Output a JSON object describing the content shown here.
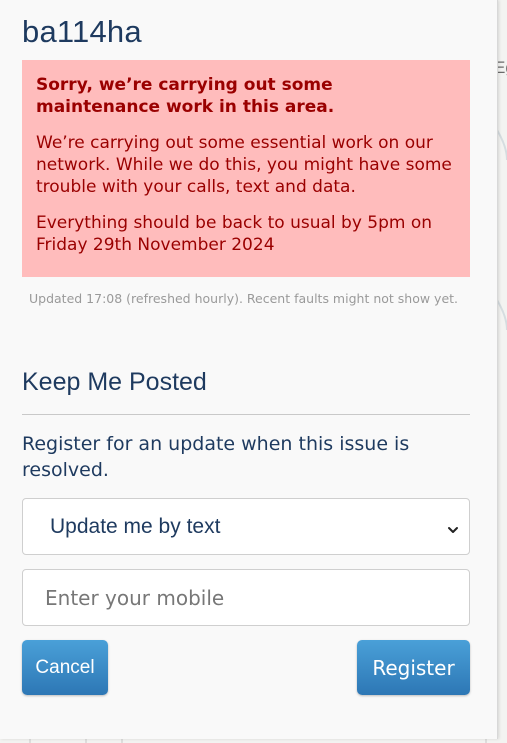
{
  "map": {
    "visible_label": "Eg"
  },
  "panel": {
    "title": "ba114ha",
    "alert": {
      "headline": "Sorry, we’re carrying out some maintenance work in this area.",
      "message": "We’re carrying out some essential work on our network. While we do this, you might have some trouble with your calls, text and data.",
      "eta": "Everything should be back to usual by 5pm on Friday 29th November 2024",
      "background_color": "#ffbcbc",
      "text_color": "#9a0000"
    },
    "updated_text": "Updated 17:08 (refreshed hourly). Recent faults might not show yet.",
    "keep_posted": {
      "heading": "Keep Me Posted",
      "description": "Register for an update when this issue is resolved.",
      "notify_method": {
        "selected": "Update me by text",
        "icon": "chevron-down-icon"
      },
      "mobile_input": {
        "value": "",
        "placeholder": "Enter your mobile"
      },
      "cancel_label": "Cancel",
      "register_label": "Register",
      "button_color": "#2d77b5"
    }
  }
}
